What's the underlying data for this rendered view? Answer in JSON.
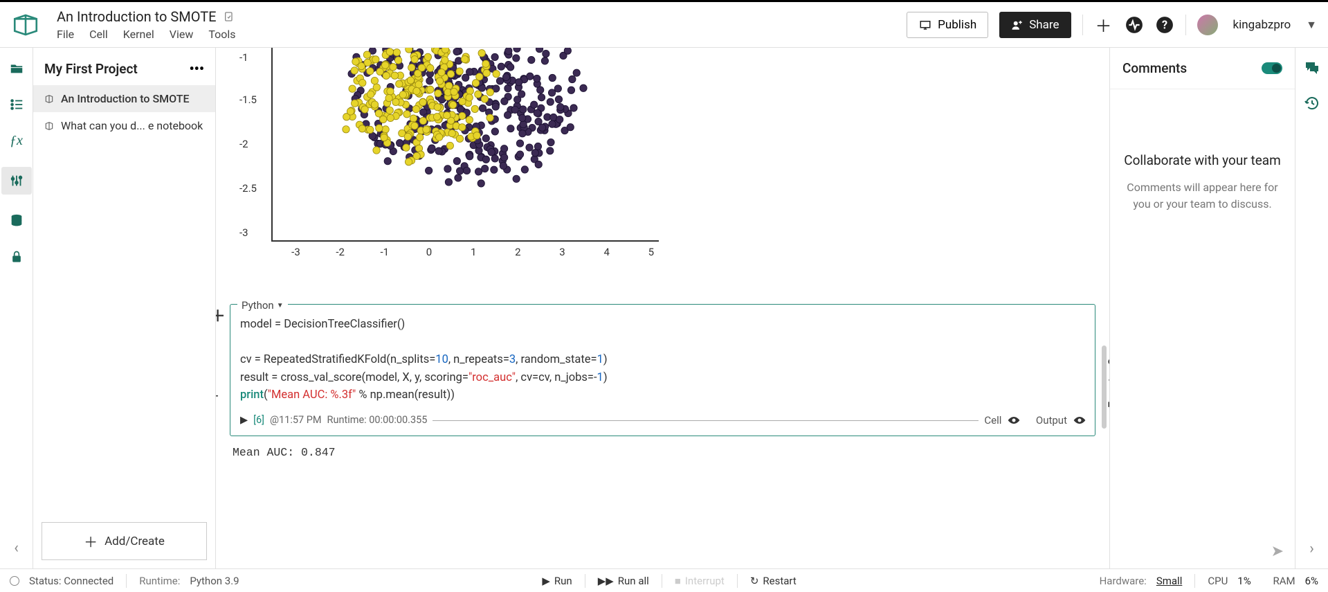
{
  "header": {
    "title": "An Introduction to SMOTE",
    "menu": [
      "File",
      "Cell",
      "Kernel",
      "View",
      "Tools"
    ],
    "publish": "Publish",
    "share": "Share",
    "username": "kingabzpro"
  },
  "sidebar": {
    "project_title": "My First Project",
    "items": [
      {
        "label": "An Introduction to SMOTE",
        "active": true
      },
      {
        "label": "What can you d... e notebook",
        "active": false
      }
    ],
    "add_create": "Add/Create"
  },
  "chart_data": {
    "type": "scatter",
    "xlim": [
      -3.5,
      5
    ],
    "ylim": [
      -3.2,
      -0.8
    ],
    "x_ticks": [
      -3,
      -2,
      -1,
      0,
      1,
      2,
      3,
      4,
      5
    ],
    "y_ticks": [
      -1.0,
      -1.5,
      -2.0,
      -2.5,
      -3.0
    ],
    "series": [
      {
        "name": "class-0-purple",
        "color": "#3b2a53",
        "approx_count": 400,
        "cluster_center": [
          0.8,
          -1.3
        ],
        "spread": [
          2.4,
          1.1
        ]
      },
      {
        "name": "class-1-yellow",
        "color": "#e6d42a",
        "approx_count": 250,
        "cluster_center": [
          -0.3,
          -1.3
        ],
        "spread": [
          1.6,
          0.8
        ]
      }
    ]
  },
  "cell": {
    "language": "Python",
    "code_lines": [
      {
        "parts": [
          {
            "t": "model = DecisionTreeClassifier()",
            "c": ""
          }
        ]
      },
      {
        "parts": []
      },
      {
        "parts": [
          {
            "t": "cv = RepeatedStratifiedKFold(n_splits=",
            "c": ""
          },
          {
            "t": "10",
            "c": "num"
          },
          {
            "t": ", n_repeats=",
            "c": ""
          },
          {
            "t": "3",
            "c": "num"
          },
          {
            "t": ", random_state=",
            "c": ""
          },
          {
            "t": "1",
            "c": "num"
          },
          {
            "t": ")",
            "c": ""
          }
        ]
      },
      {
        "parts": [
          {
            "t": "result = cross_val_score(model, X, y, scoring=",
            "c": ""
          },
          {
            "t": "\"roc_auc\"",
            "c": "str"
          },
          {
            "t": ", cv=cv, n_jobs=-",
            "c": ""
          },
          {
            "t": "1",
            "c": "num"
          },
          {
            "t": ")",
            "c": ""
          }
        ]
      },
      {
        "parts": [
          {
            "t": "print",
            "c": "fn"
          },
          {
            "t": "(",
            "c": ""
          },
          {
            "t": "\"Mean AUC: %.3f\"",
            "c": "str"
          },
          {
            "t": " % np.mean(result))",
            "c": ""
          }
        ]
      }
    ],
    "exec_count": "[6]",
    "exec_time": "@11:57 PM",
    "runtime": "Runtime: 00:00:00.355",
    "cell_label": "Cell",
    "output_label": "Output",
    "output": "Mean AUC: 0.847"
  },
  "comments": {
    "title": "Comments",
    "collab_title": "Collaborate with your team",
    "collab_sub": "Comments will appear here for you or your team to discuss."
  },
  "status": {
    "status_text": "Status: Connected",
    "runtime_label": "Runtime:",
    "runtime_value": "Python 3.9",
    "run": "Run",
    "run_all": "Run all",
    "interrupt": "Interrupt",
    "restart": "Restart",
    "hardware_label": "Hardware:",
    "hardware_value": "Small",
    "cpu_label": "CPU",
    "cpu_value": "1%",
    "ram_label": "RAM",
    "ram_value": "6%"
  }
}
